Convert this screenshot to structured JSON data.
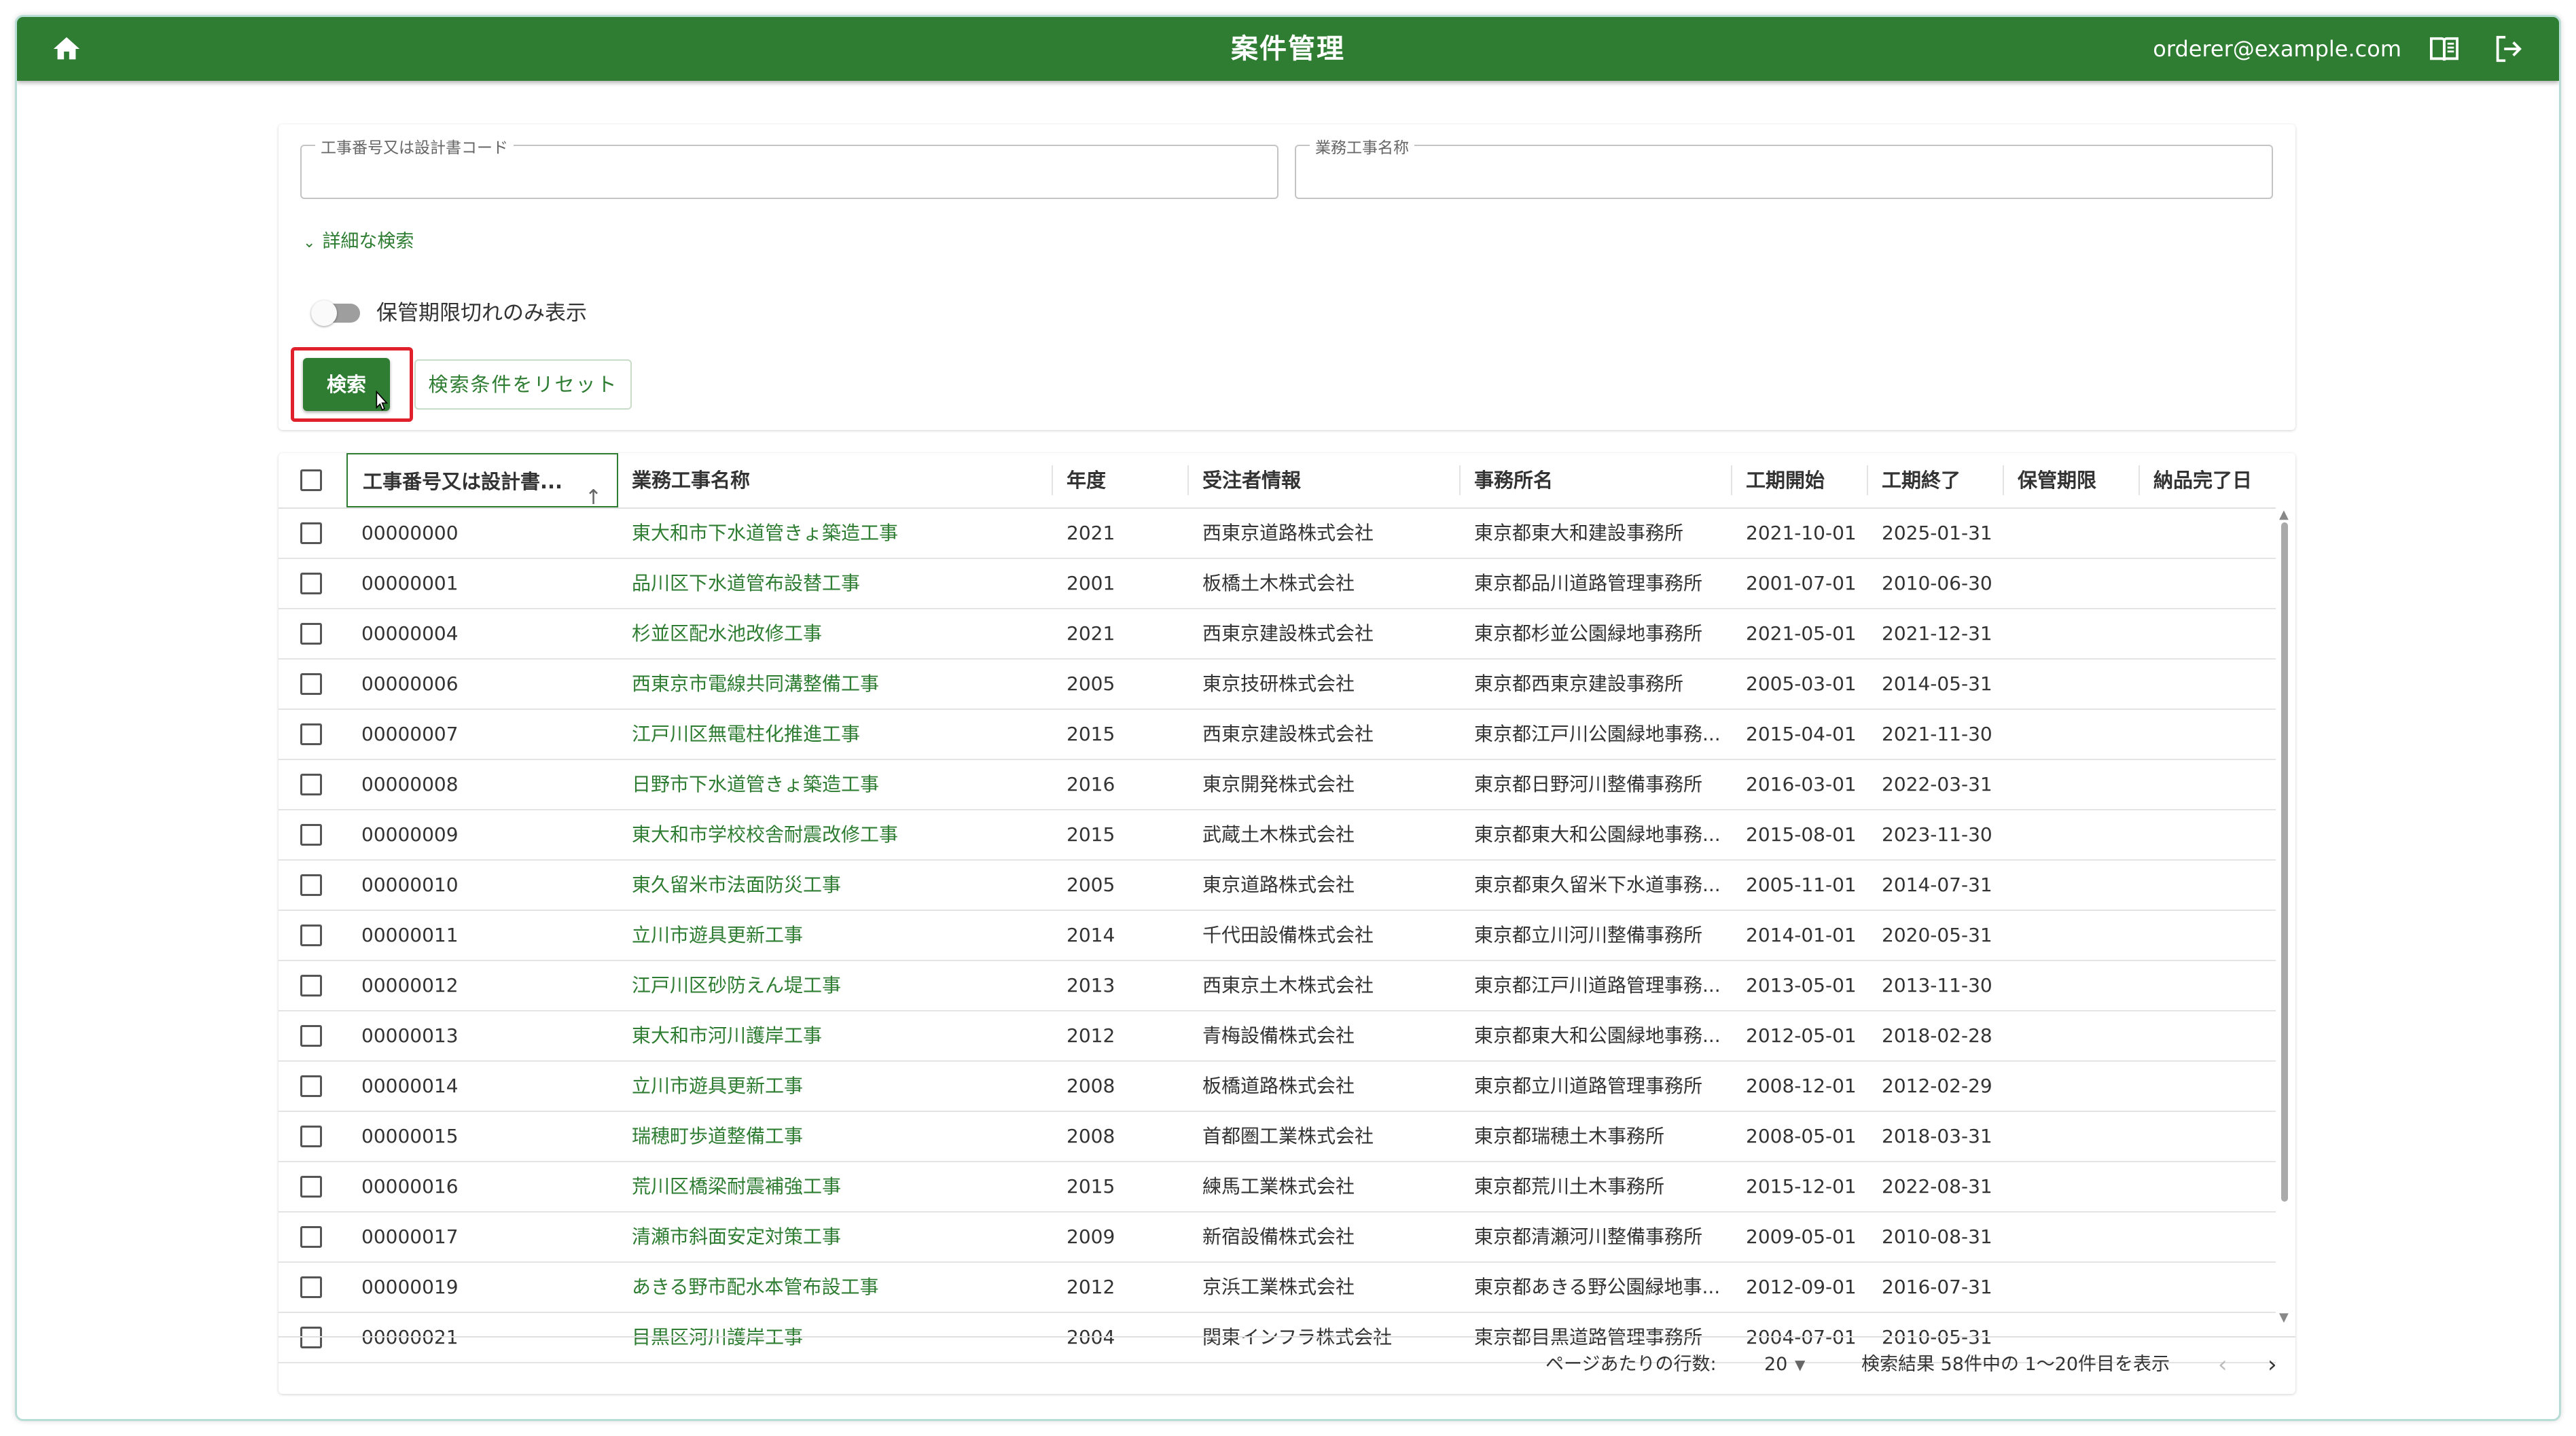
{
  "header": {
    "title": "案件管理",
    "user_email": "orderer@example.com"
  },
  "search": {
    "field1_label": "工事番号又は設計書コード",
    "field1_value": "",
    "field2_label": "業務工事名称",
    "field2_value": "",
    "advanced_label": "詳細な検索",
    "toggle_label": "保管期限切れのみ表示",
    "search_button": "検索",
    "reset_button": "検索条件をリセット"
  },
  "table": {
    "columns": [
      "工事番号又は設計書...",
      "業務工事名称",
      "年度",
      "受注者情報",
      "事務所名",
      "工期開始",
      "工期終了",
      "保管期限",
      "納品完了日"
    ],
    "rows": [
      {
        "code": "00000000",
        "name": "東大和市下水道管きょ築造工事",
        "year": "2021",
        "contractor": "西東京道路株式会社",
        "office": "東京都東大和建設事務所",
        "start": "2021-10-01",
        "end": "2025-01-31",
        "retention": "",
        "delivered": ""
      },
      {
        "code": "00000001",
        "name": "品川区下水道管布設替工事",
        "year": "2001",
        "contractor": "板橋土木株式会社",
        "office": "東京都品川道路管理事務所",
        "start": "2001-07-01",
        "end": "2010-06-30",
        "retention": "",
        "delivered": ""
      },
      {
        "code": "00000004",
        "name": "杉並区配水池改修工事",
        "year": "2021",
        "contractor": "西東京建設株式会社",
        "office": "東京都杉並公園緑地事務所",
        "start": "2021-05-01",
        "end": "2021-12-31",
        "retention": "",
        "delivered": ""
      },
      {
        "code": "00000006",
        "name": "西東京市電線共同溝整備工事",
        "year": "2005",
        "contractor": "東京技研株式会社",
        "office": "東京都西東京建設事務所",
        "start": "2005-03-01",
        "end": "2014-05-31",
        "retention": "",
        "delivered": ""
      },
      {
        "code": "00000007",
        "name": "江戸川区無電柱化推進工事",
        "year": "2015",
        "contractor": "西東京建設株式会社",
        "office": "東京都江戸川公園緑地事務...",
        "start": "2015-04-01",
        "end": "2021-11-30",
        "retention": "",
        "delivered": ""
      },
      {
        "code": "00000008",
        "name": "日野市下水道管きょ築造工事",
        "year": "2016",
        "contractor": "東京開発株式会社",
        "office": "東京都日野河川整備事務所",
        "start": "2016-03-01",
        "end": "2022-03-31",
        "retention": "",
        "delivered": ""
      },
      {
        "code": "00000009",
        "name": "東大和市学校校舎耐震改修工事",
        "year": "2015",
        "contractor": "武蔵土木株式会社",
        "office": "東京都東大和公園緑地事務...",
        "start": "2015-08-01",
        "end": "2023-11-30",
        "retention": "",
        "delivered": ""
      },
      {
        "code": "00000010",
        "name": "東久留米市法面防災工事",
        "year": "2005",
        "contractor": "東京道路株式会社",
        "office": "東京都東久留米下水道事務...",
        "start": "2005-11-01",
        "end": "2014-07-31",
        "retention": "",
        "delivered": ""
      },
      {
        "code": "00000011",
        "name": "立川市遊具更新工事",
        "year": "2014",
        "contractor": "千代田設備株式会社",
        "office": "東京都立川河川整備事務所",
        "start": "2014-01-01",
        "end": "2020-05-31",
        "retention": "",
        "delivered": ""
      },
      {
        "code": "00000012",
        "name": "江戸川区砂防えん堤工事",
        "year": "2013",
        "contractor": "西東京土木株式会社",
        "office": "東京都江戸川道路管理事務...",
        "start": "2013-05-01",
        "end": "2013-11-30",
        "retention": "",
        "delivered": ""
      },
      {
        "code": "00000013",
        "name": "東大和市河川護岸工事",
        "year": "2012",
        "contractor": "青梅設備株式会社",
        "office": "東京都東大和公園緑地事務...",
        "start": "2012-05-01",
        "end": "2018-02-28",
        "retention": "",
        "delivered": ""
      },
      {
        "code": "00000014",
        "name": "立川市遊具更新工事",
        "year": "2008",
        "contractor": "板橋道路株式会社",
        "office": "東京都立川道路管理事務所",
        "start": "2008-12-01",
        "end": "2012-02-29",
        "retention": "",
        "delivered": ""
      },
      {
        "code": "00000015",
        "name": "瑞穂町歩道整備工事",
        "year": "2008",
        "contractor": "首都圏工業株式会社",
        "office": "東京都瑞穂土木事務所",
        "start": "2008-05-01",
        "end": "2018-03-31",
        "retention": "",
        "delivered": ""
      },
      {
        "code": "00000016",
        "name": "荒川区橋梁耐震補強工事",
        "year": "2015",
        "contractor": "練馬工業株式会社",
        "office": "東京都荒川土木事務所",
        "start": "2015-12-01",
        "end": "2022-08-31",
        "retention": "",
        "delivered": ""
      },
      {
        "code": "00000017",
        "name": "清瀬市斜面安定対策工事",
        "year": "2009",
        "contractor": "新宿設備株式会社",
        "office": "東京都清瀬河川整備事務所",
        "start": "2009-05-01",
        "end": "2010-08-31",
        "retention": "",
        "delivered": ""
      },
      {
        "code": "00000019",
        "name": "あきる野市配水本管布設工事",
        "year": "2012",
        "contractor": "京浜工業株式会社",
        "office": "東京都あきる野公園緑地事...",
        "start": "2012-09-01",
        "end": "2016-07-31",
        "retention": "",
        "delivered": ""
      },
      {
        "code": "00000021",
        "name": "目黒区河川護岸工事",
        "year": "2004",
        "contractor": "関東インフラ株式会社",
        "office": "東京都目黒道路管理事務所",
        "start": "2004-07-01",
        "end": "2010-05-31",
        "retention": "",
        "delivered": ""
      }
    ]
  },
  "pagination": {
    "rows_per_page_label": "ページあたりの行数:",
    "rows_per_page": "20",
    "range_text": "検索結果 58件中の 1〜20件目を表示"
  },
  "colors": {
    "primary": "#2e7d32",
    "highlight": "#e0202a"
  },
  "icons": [
    "home-icon",
    "manual-book-icon",
    "logout-icon",
    "chevron-down-icon",
    "sort-arrow-up-icon",
    "chevron-left-icon",
    "chevron-right-icon"
  ]
}
